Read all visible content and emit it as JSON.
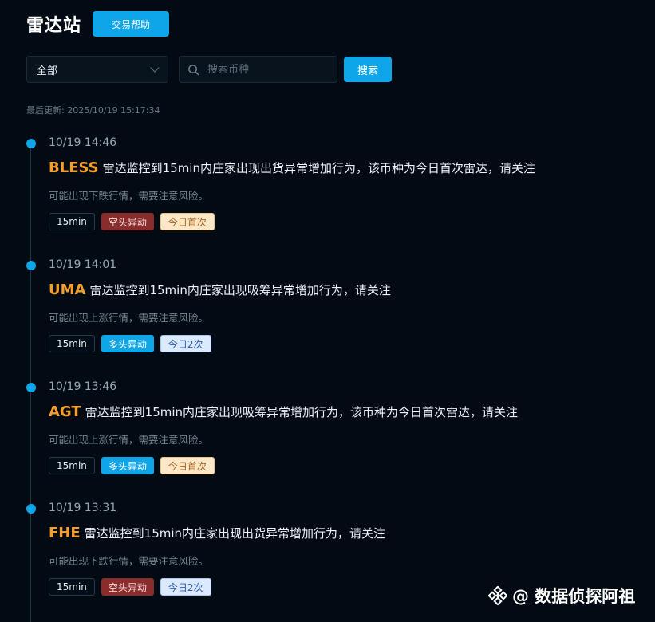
{
  "header": {
    "title": "雷达站",
    "help_label": "交易帮助"
  },
  "filters": {
    "select_value": "全部",
    "search_placeholder": "搜索币种",
    "search_button": "搜索"
  },
  "last_updated": "最后更新: 2025/10/19 15:17:34",
  "entries": [
    {
      "time": "10/19 14:46",
      "coin": "BLESS",
      "message": "雷达监控到15min内庄家出现出货异常增加行为，该币种为今日首次雷达，请关注",
      "sub": "可能出现下跌行情，需要注意风险。",
      "tags": [
        "15min",
        "空头异动",
        "今日首次"
      ]
    },
    {
      "time": "10/19 14:01",
      "coin": "UMA",
      "message": "雷达监控到15min内庄家出现吸筹异常增加行为，请关注",
      "sub": "可能出现上涨行情，需要注意风险。",
      "tags": [
        "15min",
        "多头异动",
        "今日2次"
      ]
    },
    {
      "time": "10/19 13:46",
      "coin": "AGT",
      "message": "雷达监控到15min内庄家出现吸筹异常增加行为，该币种为今日首次雷达，请关注",
      "sub": "可能出现上涨行情，需要注意风险。",
      "tags": [
        "15min",
        "多头异动",
        "今日首次"
      ]
    },
    {
      "time": "10/19 13:31",
      "coin": "FHE",
      "message": "雷达监控到15min内庄家出现出货异常增加行为，请关注",
      "sub": "可能出现下跌行情，需要注意风险。",
      "tags": [
        "15min",
        "空头异动",
        "今日2次"
      ]
    }
  ],
  "watermark": {
    "text": "@ 数据侦探阿祖"
  }
}
